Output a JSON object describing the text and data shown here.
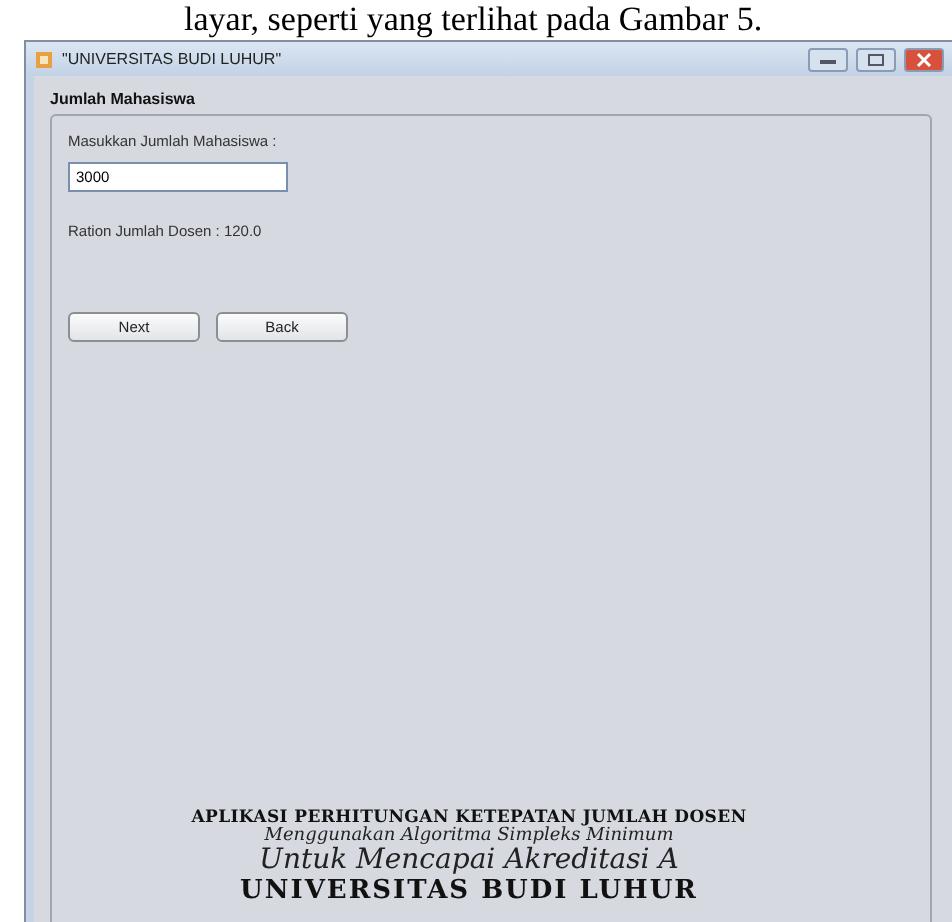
{
  "caption": "layar, seperti yang terlihat pada Gambar 5.",
  "window": {
    "title": "\"UNIVERSITAS BUDI LUHUR\""
  },
  "panel": {
    "title": "Jumlah Mahasiswa",
    "input_label": "Masukkan Jumlah Mahasiswa :",
    "input_value": "3000",
    "result": "Ration Jumlah Dosen : 120.0",
    "buttons": [
      "Next",
      "Back"
    ]
  },
  "footer": {
    "heading": "APLIKASI PERHITUNGAN KETEPATAN JUMLAH DOSEN",
    "subtitle": "Menggunakan Algoritma Simpleks Minimum",
    "tagline": "Untuk Mencapai Akreditasi A",
    "university": "UNIVERSITAS BUDI LUHUR"
  }
}
